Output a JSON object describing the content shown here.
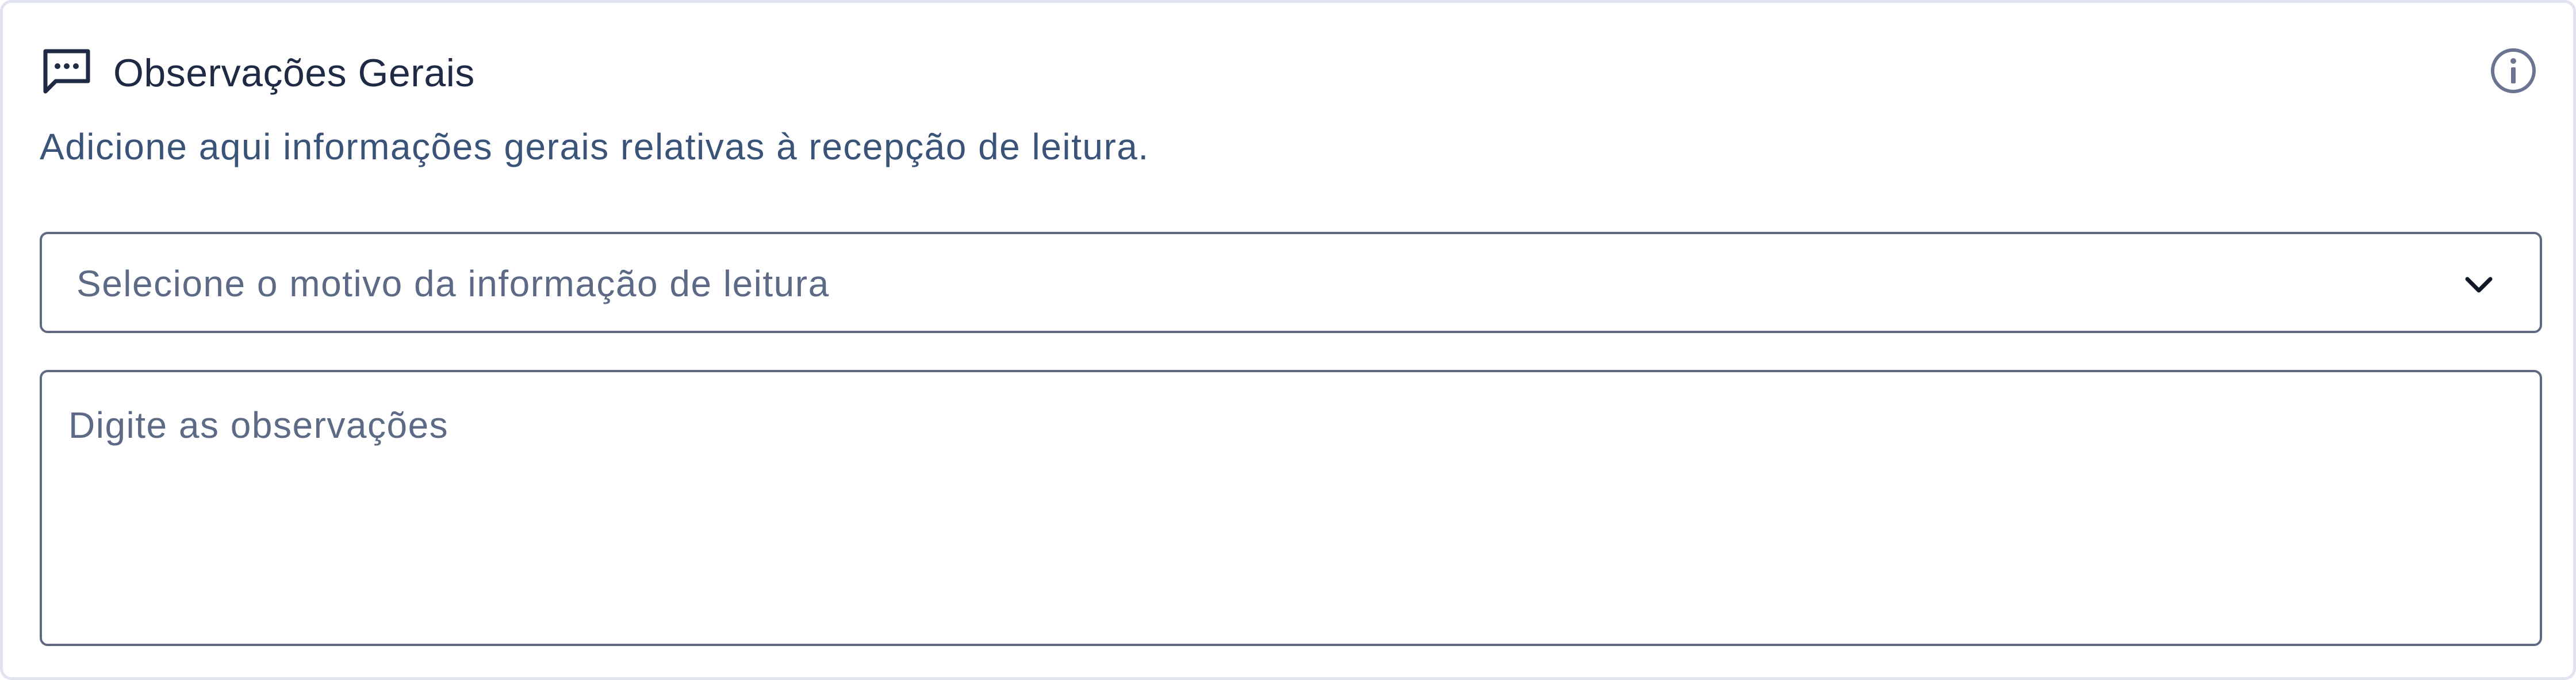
{
  "header": {
    "icon": "message-dots-icon",
    "title": "Observações Gerais",
    "info_icon": "info-icon"
  },
  "description": "Adicione aqui informações gerais relativas à recepção de leitura.",
  "reason_select": {
    "placeholder": "Selecione o motivo da informação de leitura",
    "icon": "chevron-down-icon"
  },
  "observations": {
    "placeholder": "Digite as observações"
  },
  "colors": {
    "title": "#1f2a44",
    "description": "#3a5378",
    "border": "#5f6982",
    "placeholder": "#5c6a86",
    "card_border": "#e1e3f0"
  }
}
